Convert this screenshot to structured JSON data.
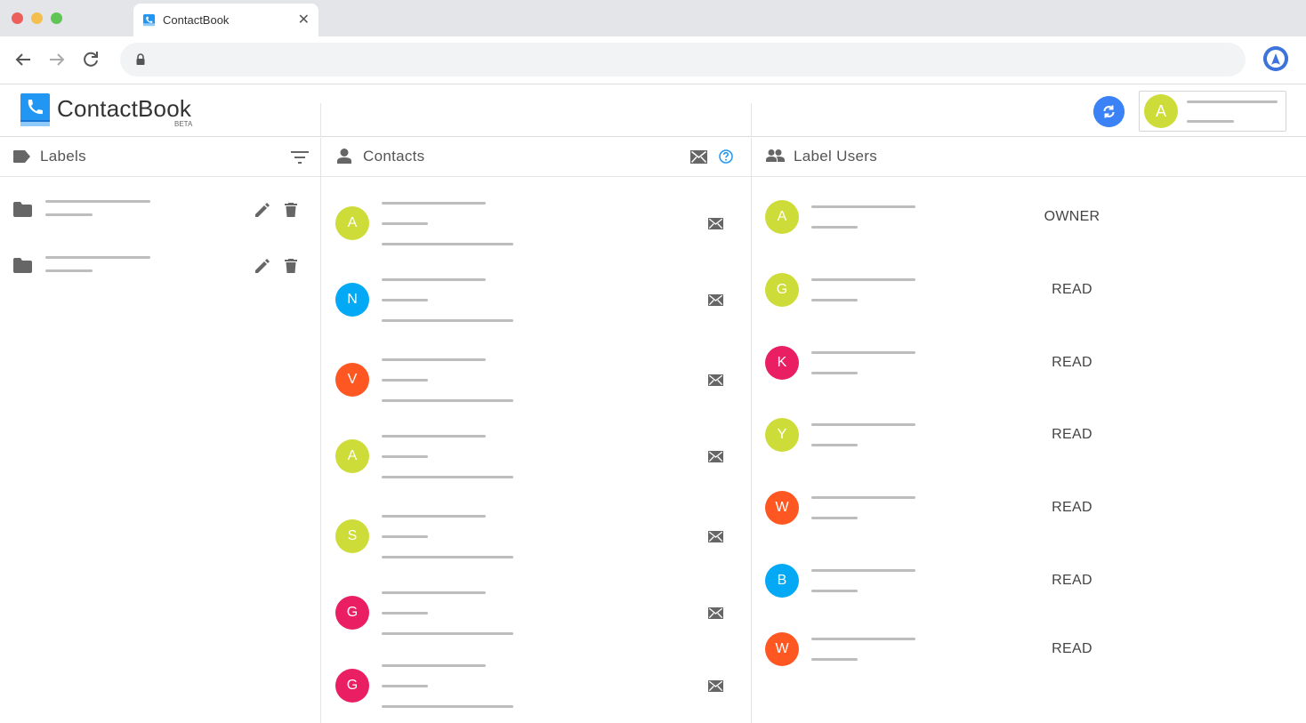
{
  "browser": {
    "tab_title": "ContactBook",
    "tab_close": "✕"
  },
  "app": {
    "title": "ContactBook",
    "badge": "BETA",
    "account_initial": "A"
  },
  "labels_panel": {
    "title": "Labels",
    "rows": [
      {
        "label": ""
      },
      {
        "label": ""
      }
    ]
  },
  "contacts_panel": {
    "title": "Contacts",
    "contacts": [
      {
        "initial": "A",
        "color": "#cddc39"
      },
      {
        "initial": "N",
        "color": "#03a9f4"
      },
      {
        "initial": "V",
        "color": "#ff5722"
      },
      {
        "initial": "A",
        "color": "#cddc39"
      },
      {
        "initial": "S",
        "color": "#cddc39"
      },
      {
        "initial": "G",
        "color": "#e91e63"
      },
      {
        "initial": "G",
        "color": "#e91e63"
      }
    ]
  },
  "users_panel": {
    "title": "Label Users",
    "users": [
      {
        "initial": "A",
        "color": "#cddc39",
        "permission": "OWNER"
      },
      {
        "initial": "G",
        "color": "#cddc39",
        "permission": "READ"
      },
      {
        "initial": "K",
        "color": "#e91e63",
        "permission": "READ"
      },
      {
        "initial": "Y",
        "color": "#cddc39",
        "permission": "READ"
      },
      {
        "initial": "W",
        "color": "#ff5722",
        "permission": "READ"
      },
      {
        "initial": "B",
        "color": "#03a9f4",
        "permission": "READ"
      },
      {
        "initial": "W",
        "color": "#ff5722",
        "permission": "READ"
      }
    ]
  },
  "colors": {
    "accent": "#3b82f6",
    "brand": "#2196f3"
  }
}
